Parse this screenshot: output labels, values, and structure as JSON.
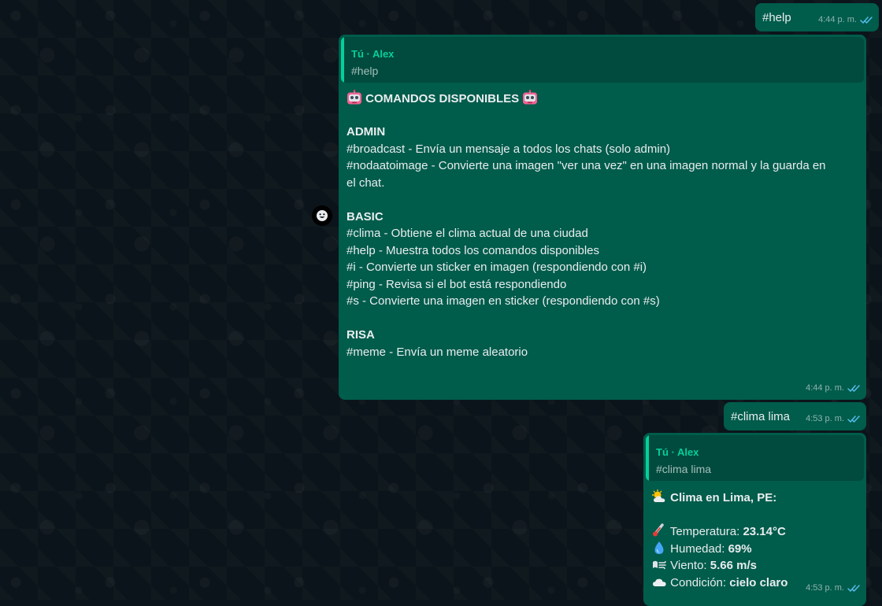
{
  "messages": {
    "help_cmd": {
      "text": "#help",
      "time": "4:44 p. m."
    },
    "help_reply": {
      "quote_name": "Tú · Alex",
      "quote_text": "#help",
      "title": "COMANDOS DISPONIBLES",
      "sections": [
        {
          "heading": "ADMIN",
          "lines": [
            "#broadcast - Envía un mensaje a todos los chats (solo admin)",
            "#nodaatoimage - Convierte una imagen \"ver una vez\" en una imagen normal y la guarda en",
            "el chat."
          ]
        },
        {
          "heading": "BASIC",
          "lines": [
            "#clima - Obtiene el clima actual de una ciudad",
            "#help - Muestra todos los comandos disponibles",
            "#i - Convierte un sticker en imagen (respondiendo con #i)",
            "#ping - Revisa si el bot está respondiendo",
            "#s - Convierte una imagen en sticker (respondiendo con #s)"
          ]
        },
        {
          "heading": "RISA",
          "lines": [
            "#meme - Envía un meme aleatorio"
          ]
        }
      ],
      "time": "4:44 p. m."
    },
    "clima_cmd": {
      "text": "#clima lima",
      "time": "4:53 p. m."
    },
    "clima_reply": {
      "quote_name": "Tú · Alex",
      "quote_text": "#clima lima",
      "title": "Clima en Lima, PE:",
      "temp_label": "Temperatura:",
      "temp_value": "23.14°C",
      "hum_label": "Humedad:",
      "hum_value": "69%",
      "wind_label": "Viento:",
      "wind_value": "5.66 m/s",
      "cond_label": "Condición:",
      "cond_value": "cielo claro",
      "time": "4:53 p. m."
    }
  },
  "icons": {
    "robot": "robot-icon",
    "sun_cloud": "sun-behind-cloud-icon",
    "thermometer": "thermometer-icon",
    "droplet": "droplet-icon",
    "wind": "wind-icon",
    "cloud": "cloud-icon",
    "react": "emoji-react-icon",
    "ticks": "double-check-icon"
  },
  "colors": {
    "bubble": "#005c4b",
    "quote_accent": "#06cf9c",
    "read_ticks": "#53bdeb",
    "background": "#0b141a"
  }
}
